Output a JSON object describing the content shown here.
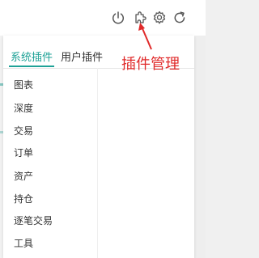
{
  "toolbar": {
    "icons": [
      "power-icon",
      "plugin-icon",
      "gear-icon",
      "refresh-icon"
    ]
  },
  "tabs": [
    {
      "label": "系统插件",
      "active": true
    },
    {
      "label": "用户插件",
      "active": false
    }
  ],
  "plugin_list": [
    {
      "label": "图表"
    },
    {
      "label": "深度"
    },
    {
      "label": "交易"
    },
    {
      "label": "订单"
    },
    {
      "label": "资产"
    },
    {
      "label": "持仓"
    },
    {
      "label": "逐笔交易"
    },
    {
      "label": "工具"
    }
  ],
  "annotation": {
    "text": "插件管理",
    "color": "#e02a2a"
  },
  "colors": {
    "accent": "#1fa297"
  }
}
